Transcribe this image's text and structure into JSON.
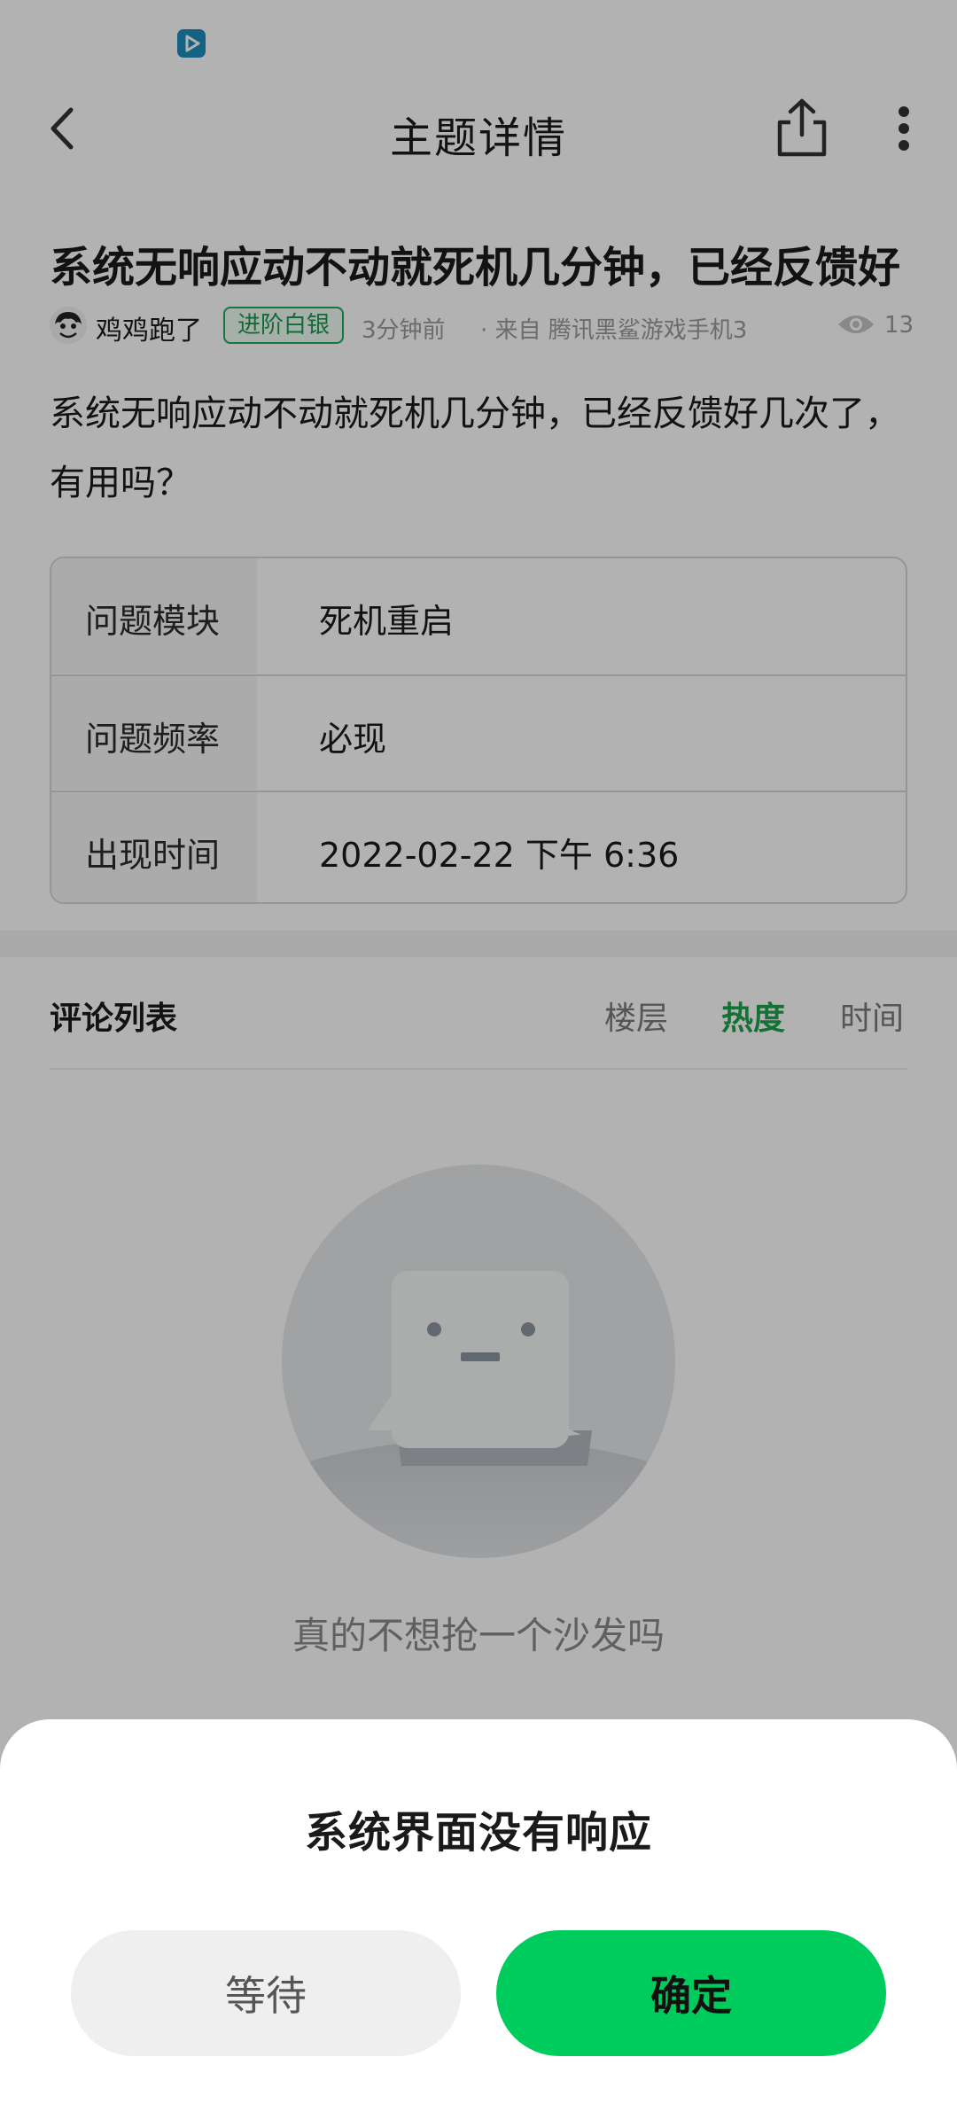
{
  "status_bar": {
    "app_icon": "video-play-icon"
  },
  "top_bar": {
    "title": "主题详情",
    "back_icon": "chevron-left-icon",
    "share_icon": "share-icon",
    "more_icon": "more-vertical-icon"
  },
  "post": {
    "title": "系统无响应动不动就死机几分钟，已经反馈好",
    "author": "鸡鸡跑了",
    "badge": "进阶白银",
    "time": "3分钟前",
    "source": "· 来自 腾讯黑鲨游戏手机3",
    "views": "13",
    "body": "系统无响应动不动就死机几分钟，已经反馈好几次了，有用吗？",
    "info_table": [
      {
        "label": "问题模块",
        "value": "死机重启"
      },
      {
        "label": "问题频率",
        "value": "必现"
      },
      {
        "label": "出现时间",
        "value": "2022-02-22 下午 6:36"
      }
    ]
  },
  "comments": {
    "title": "评论列表",
    "sort_tabs": [
      "楼层",
      "热度",
      "时间"
    ],
    "active_sort": "热度",
    "empty_text": "真的不想抢一个沙发吗"
  },
  "dialog": {
    "title": "系统界面没有响应",
    "wait_label": "等待",
    "confirm_label": "确定"
  },
  "colors": {
    "accent": "#00cc5e",
    "active_tab": "#1aa34a",
    "badge": "#1fae56",
    "scrim": "rgba(0,0,0,0.30)"
  }
}
